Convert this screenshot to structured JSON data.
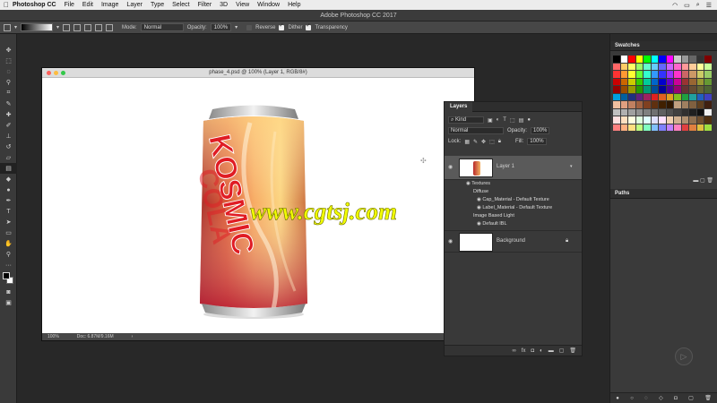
{
  "menubar": {
    "app_name": "Photoshop CC",
    "items": [
      "File",
      "Edit",
      "Image",
      "Layer",
      "Type",
      "Select",
      "Filter",
      "3D",
      "View",
      "Window",
      "Help"
    ]
  },
  "window_title": "Adobe Photoshop CC 2017",
  "options": {
    "mode_label": "Mode:",
    "mode_value": "Normal",
    "opacity_label": "Opacity:",
    "opacity_value": "100%",
    "reverse_label": "Reverse",
    "dither_label": "Dither",
    "transparency_label": "Transparency",
    "reverse_checked": false,
    "dither_checked": true,
    "transparency_checked": true
  },
  "document": {
    "title": "phase_4.psd @ 100% (Layer 1, RGB/8#)",
    "zoom": "100%",
    "doc_size": "Doc: 6.87M/9.16M",
    "can_text_1": "KOSMIC",
    "can_text_2": "COLA",
    "watermark": "www.cgtsj.com"
  },
  "layers_panel": {
    "tab_label": "Layers",
    "kind_label": "Kind",
    "blend_mode": "Normal",
    "opacity_label": "Opacity:",
    "opacity_value": "100%",
    "lock_label": "Lock:",
    "fill_label": "Fill:",
    "fill_value": "100%",
    "layer1_name": "Layer 1",
    "textures_label": "Textures",
    "diffuse_label": "Diffuse",
    "cap_material": "Cap_Material - Default Texture",
    "label_material": "Label_Material - Default Texture",
    "ibl_label": "Image Based Light",
    "default_ibl": "Default IBL",
    "background_name": "Background"
  },
  "right_dock": {
    "swatches_tab": "Swatches",
    "paths_tab": "Paths",
    "swatch_colors": [
      "#000000",
      "#ffffff",
      "#ff0000",
      "#ffff00",
      "#00ff00",
      "#00ffff",
      "#0000ff",
      "#ff00ff",
      "#cccccc",
      "#999999",
      "#666666",
      "#333333",
      "#7f0000",
      "#ff6666",
      "#ffcc66",
      "#ffff66",
      "#99ff66",
      "#66ffcc",
      "#66ccff",
      "#6666ff",
      "#cc66ff",
      "#ff66cc",
      "#ff9999",
      "#ffcc99",
      "#ffff99",
      "#ccff99",
      "#ff3333",
      "#ff9933",
      "#ffff33",
      "#66ff33",
      "#33ffcc",
      "#3399ff",
      "#3333ff",
      "#9933ff",
      "#ff33cc",
      "#cc6666",
      "#cc9966",
      "#cccc66",
      "#99cc66",
      "#cc0000",
      "#cc6600",
      "#cccc00",
      "#33cc00",
      "#00cc99",
      "#0066cc",
      "#0000cc",
      "#6600cc",
      "#cc0099",
      "#993333",
      "#996633",
      "#999933",
      "#669933",
      "#990000",
      "#994c00",
      "#999900",
      "#269900",
      "#009973",
      "#004c99",
      "#000099",
      "#4c0099",
      "#990073",
      "#663333",
      "#664d33",
      "#666633",
      "#4d6633",
      "#00a0e0",
      "#0060a0",
      "#203080",
      "#602080",
      "#a02060",
      "#e02020",
      "#e06020",
      "#e0a020",
      "#80c020",
      "#20a040",
      "#20a0a0",
      "#2060c0",
      "#4040c0",
      "#f0c0a0",
      "#e0a080",
      "#c08060",
      "#a06040",
      "#804020",
      "#603010",
      "#402000",
      "#301800",
      "#c0a080",
      "#a08060",
      "#806040",
      "#604020",
      "#402010",
      "#c0c0c0",
      "#b0b0b0",
      "#a0a0a0",
      "#909090",
      "#808080",
      "#707070",
      "#606060",
      "#505050",
      "#404040",
      "#303030",
      "#202020",
      "#101010",
      "#f0f0f0",
      "#ffe0e0",
      "#ffe0c0",
      "#ffffe0",
      "#e0ffe0",
      "#e0ffff",
      "#e0e0ff",
      "#ffe0ff",
      "#f0d0b0",
      "#d0b090",
      "#b09070",
      "#907050",
      "#705030",
      "#503010",
      "#ff8080",
      "#ffb080",
      "#ffe080",
      "#c0ff80",
      "#80ffc0",
      "#80c0ff",
      "#8080ff",
      "#c080ff",
      "#ff80c0",
      "#e04040",
      "#e08040",
      "#e0c040",
      "#a0e040"
    ]
  }
}
